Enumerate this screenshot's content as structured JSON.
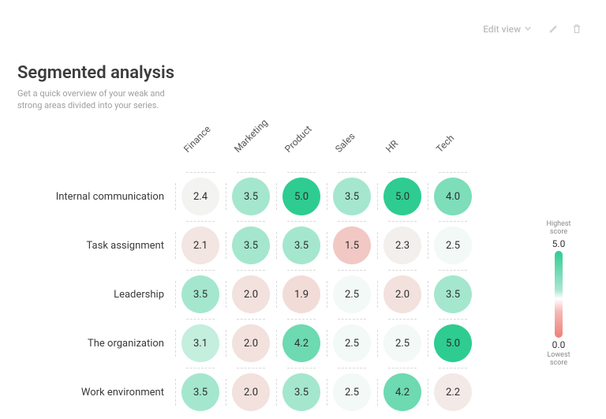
{
  "toolbar": {
    "edit_view_label": "Edit view"
  },
  "header": {
    "title": "Segmented analysis",
    "subtitle": "Get a quick overview of your weak and strong areas divided into your series."
  },
  "legend": {
    "high_caption": "Highest score",
    "high_value": "5.0",
    "low_value": "0.0",
    "low_caption": "Lowest score"
  },
  "chart_data": {
    "type": "heatmap",
    "value_range": [
      0,
      5
    ],
    "color_low": "#ef7f78",
    "color_mid": "#f3f9f6",
    "color_high": "#2ecc91",
    "columns": [
      "Finance",
      "Marketing",
      "Product",
      "Sales",
      "HR",
      "Tech"
    ],
    "rows": [
      {
        "label": "Internal communication",
        "values": [
          2.4,
          3.5,
          5.0,
          3.5,
          5.0,
          4.0
        ]
      },
      {
        "label": "Task assignment",
        "values": [
          2.1,
          3.5,
          3.5,
          1.5,
          2.3,
          2.5
        ]
      },
      {
        "label": "Leadership",
        "values": [
          3.5,
          2.0,
          1.9,
          2.5,
          2.0,
          3.5
        ]
      },
      {
        "label": "The organization",
        "values": [
          3.1,
          2.0,
          4.2,
          2.5,
          2.5,
          5.0
        ]
      },
      {
        "label": "Work environment",
        "values": [
          3.5,
          2.0,
          3.5,
          2.5,
          4.2,
          2.2
        ]
      }
    ]
  }
}
